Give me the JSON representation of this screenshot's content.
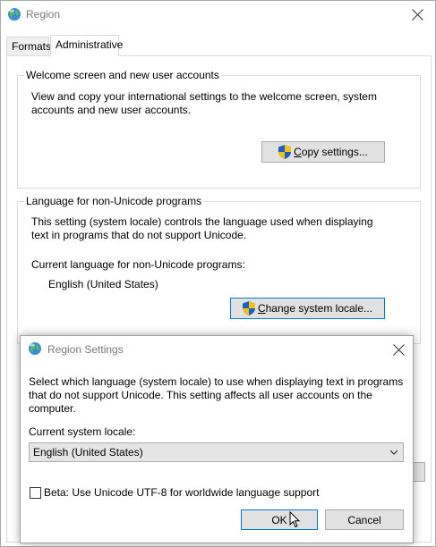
{
  "window": {
    "title": "Region",
    "tabs": [
      {
        "label": "Formats",
        "active": false
      },
      {
        "label": "Administrative",
        "active": true
      }
    ]
  },
  "welcome_group": {
    "title": "Welcome screen and new user accounts",
    "description_line1": "View and copy your international settings to the welcome screen, system",
    "description_line2": "accounts and new user accounts.",
    "copy_button": {
      "label_underlined": "C",
      "label_rest": "opy settings..."
    }
  },
  "unicode_group": {
    "title": "Language for non-Unicode programs",
    "description_line1": "This setting (system locale) controls the language used when displaying",
    "description_line2": "text in programs that do not support Unicode.",
    "current_label": "Current language for non-Unicode programs:",
    "current_value": "English (United States)",
    "change_button": {
      "label_underlined": "C",
      "label_rest": "hange system locale..."
    }
  },
  "dialog": {
    "title": "Region Settings",
    "description_line1": "Select which language (system locale) to use when displaying text in programs",
    "description_line2": "that do not support Unicode. This setting affects all user accounts on the",
    "description_line3": "computer.",
    "current_locale_label": "Current system locale:",
    "current_locale_value": "English (United States)",
    "beta_checkbox_label": "Beta: Use Unicode UTF-8 for worldwide language support",
    "beta_checked": false,
    "ok_label": "OK",
    "cancel_label": "Cancel"
  },
  "colors": {
    "focus_border": "#0078d7",
    "button_bg": "#e1e1e1",
    "title_inactive": "#7a7a7a"
  }
}
